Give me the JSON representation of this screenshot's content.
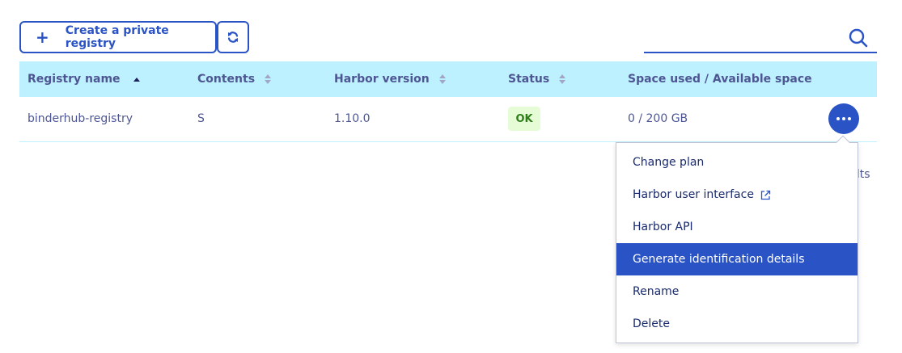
{
  "toolbar": {
    "create_label": "Create a private registry",
    "create_icon": "plus-icon",
    "refresh_icon": "refresh-icon",
    "search_placeholder": "",
    "search_icon": "search-icon"
  },
  "table": {
    "columns": [
      {
        "label": "Registry name",
        "sort": "asc"
      },
      {
        "label": "Contents",
        "sort": "none"
      },
      {
        "label": "Harbor version",
        "sort": "none"
      },
      {
        "label": "Status",
        "sort": "none"
      },
      {
        "label": "Space used / Available space",
        "sort": null
      }
    ],
    "rows": [
      {
        "name": "binderhub-registry",
        "contents": "S",
        "harbor_version": "1.10.0",
        "status": "OK",
        "space": "0 / 200 GB"
      }
    ]
  },
  "results_partial": "ults",
  "menu": {
    "items": [
      {
        "label": "Change plan"
      },
      {
        "label": "Harbor user interface",
        "icon": "external-link-icon"
      },
      {
        "label": "Harbor API"
      },
      {
        "label": "Generate identification details",
        "active": true
      },
      {
        "label": "Rename"
      },
      {
        "label": "Delete"
      }
    ]
  },
  "colors": {
    "primary": "#2a53c5",
    "header_bg": "#bef1ff",
    "text": "#4d5693",
    "status_ok_bg": "#e6fcd6",
    "status_ok_text": "#2e7f1a"
  }
}
